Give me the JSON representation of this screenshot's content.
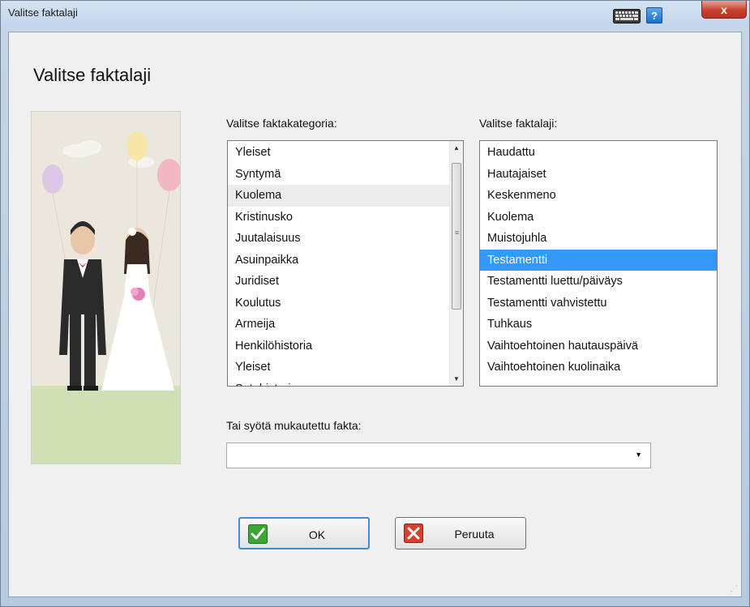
{
  "window": {
    "title": "Valitse faktalaji",
    "help_label": "?",
    "close_label": "x"
  },
  "heading": "Valitse faktalaji",
  "category": {
    "label": "Valitse faktakategoria:",
    "items": [
      "Yleiset",
      "Syntymä",
      "Kuolema",
      "Kristinusko",
      "Juutalaisuus",
      "Asuinpaikka",
      "Juridiset",
      "Koulutus",
      "Armeija",
      "Henkilöhistoria",
      "Yleiset",
      "Sotahistoria..."
    ],
    "hovered_index": 2
  },
  "fact_type": {
    "label": "Valitse faktalaji:",
    "items": [
      "Haudattu",
      "Hautajaiset",
      "Keskenmeno",
      "Kuolema",
      "Muistojuhla",
      "Testamentti",
      "Testamentti luettu/päiväys",
      "Testamentti vahvistettu",
      "Tuhkaus",
      "Vaihtoehtoinen hautauspäivä",
      "Vaihtoehtoinen kuolinaika"
    ],
    "selected_index": 5
  },
  "custom_fact": {
    "label": "Tai syötä mukautettu fakta:",
    "value": ""
  },
  "buttons": {
    "ok_label": "OK",
    "cancel_label": "Peruuta"
  },
  "colors": {
    "selection": "#3399ff",
    "ok_icon": "#3aa832",
    "cancel_icon": "#d9402b"
  },
  "icons": {
    "keyboard": "keyboard-icon",
    "help": "help-icon",
    "close": "close-icon",
    "ok": "checkmark-icon",
    "cancel": "x-icon"
  }
}
